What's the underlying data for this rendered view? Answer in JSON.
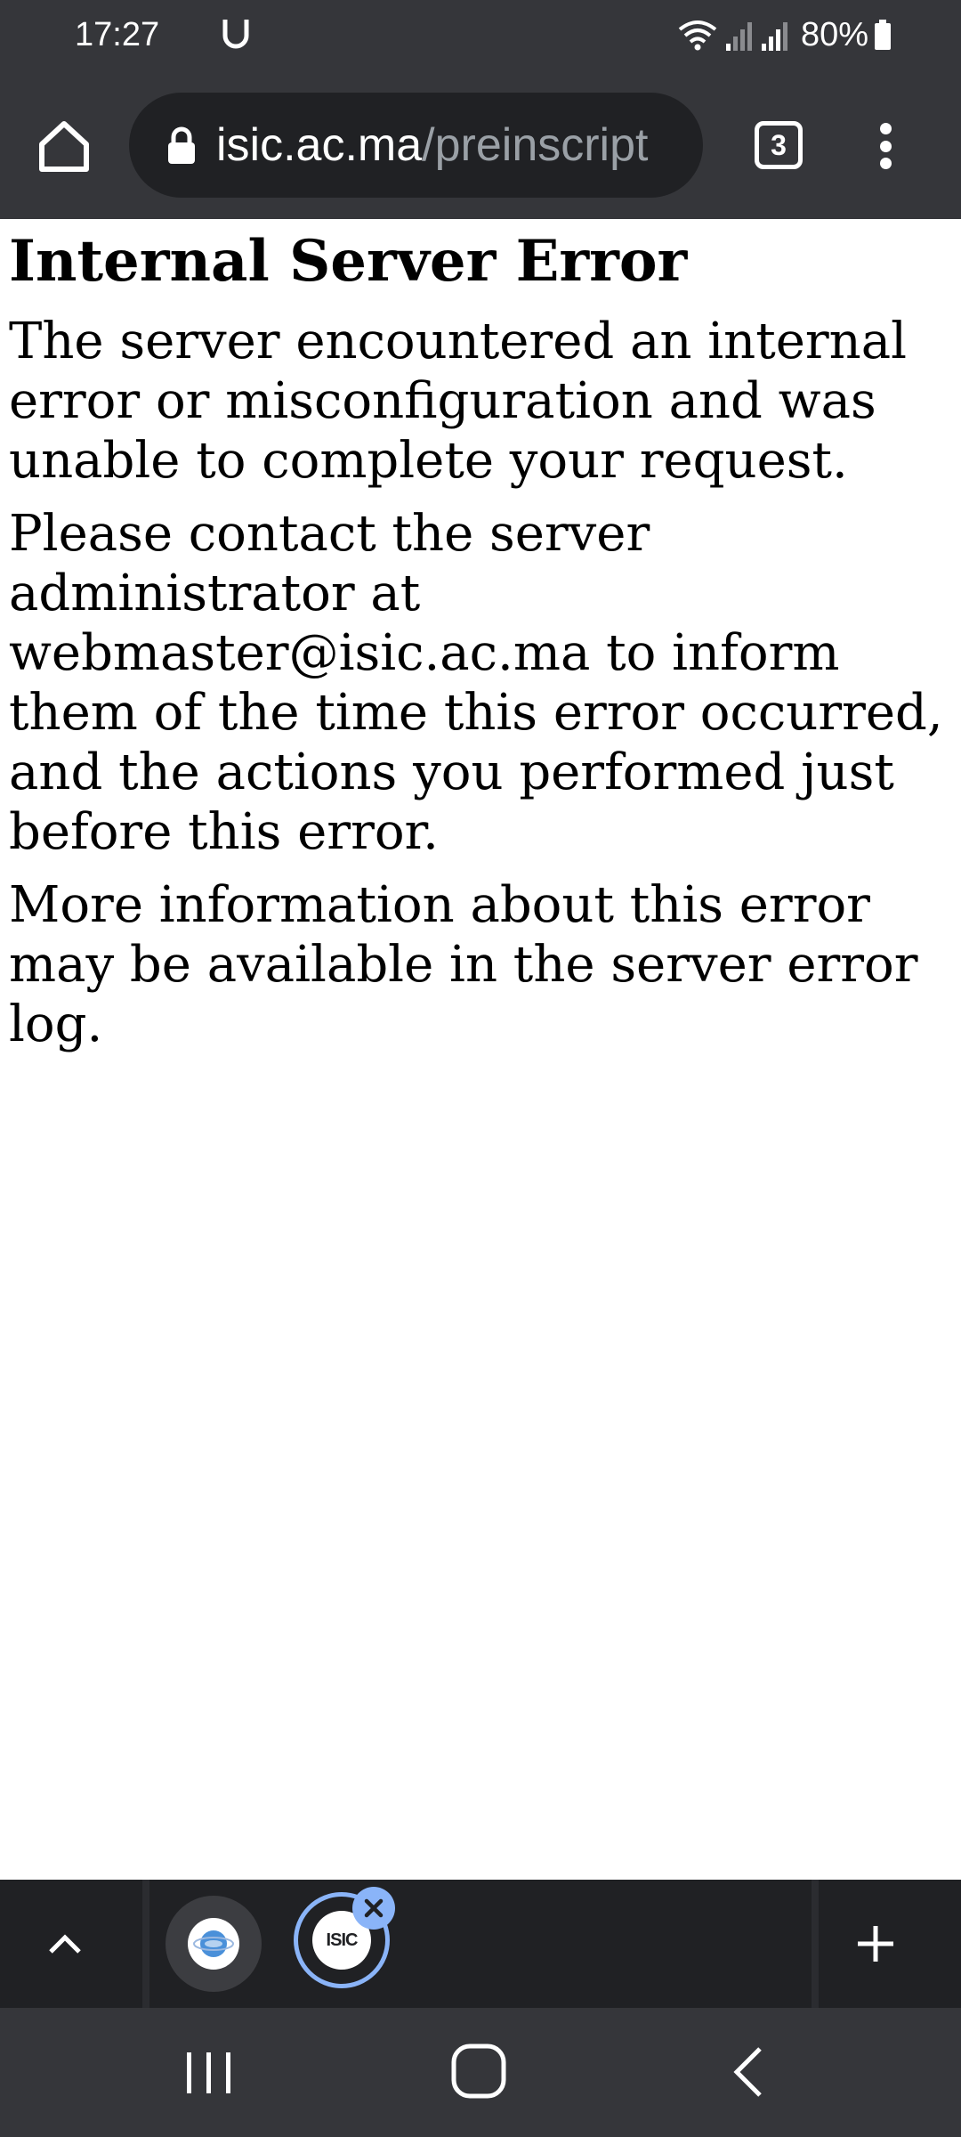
{
  "status_bar": {
    "time": "17:27",
    "carrier_icon": "u-icon",
    "battery_percent": "80%"
  },
  "browser": {
    "url_host": "isic.ac.ma",
    "url_path": "/preinscript",
    "tab_count": "3",
    "colors": {
      "chrome_bg": "#35363a",
      "omnibox_bg": "#202124",
      "accent": "#8ab4f8"
    }
  },
  "page": {
    "title": "Internal Server Error",
    "paragraphs": [
      "The server encountered an internal error or misconfiguration and was unable to complete your request.",
      "Please contact the server administrator at webmaster@isic.ac.ma to inform them of the time this error occurred, and the actions you performed just before this error.",
      "More information about this error may be available in the server error log."
    ]
  },
  "tab_strip": {
    "tabs": [
      {
        "favicon": "globe-favicon-icon",
        "selected": false
      },
      {
        "favicon": "isic-logo-icon",
        "favicon_text": "ISIC",
        "selected": true
      }
    ]
  }
}
